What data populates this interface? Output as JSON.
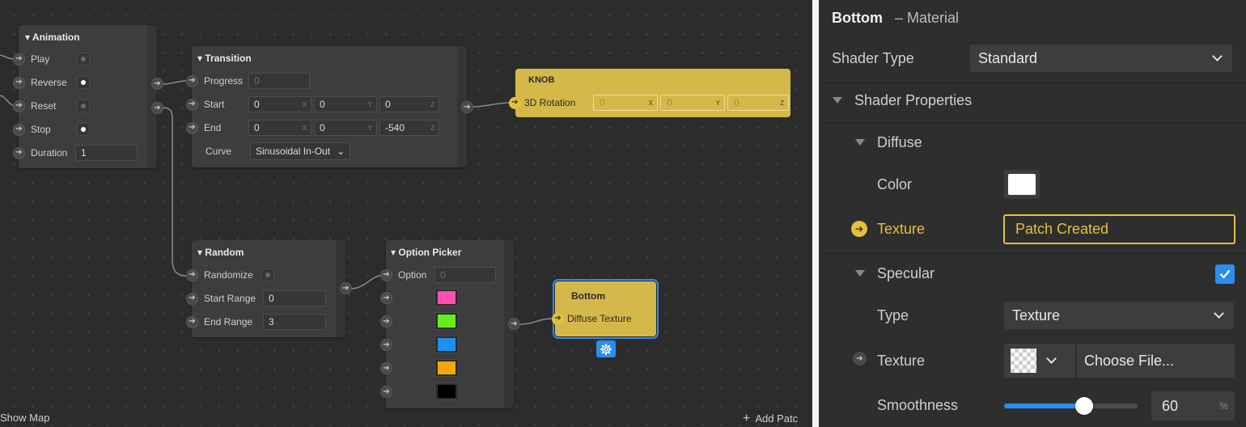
{
  "editor": {
    "show_map": "Show Map",
    "add_patch": "Add Patc",
    "animation": {
      "title": "Animation",
      "rows": [
        {
          "label": "Play",
          "checked": false
        },
        {
          "label": "Reverse",
          "checked": true
        },
        {
          "label": "Reset",
          "checked": false
        },
        {
          "label": "Stop",
          "checked": true
        }
      ],
      "duration_label": "Duration",
      "duration_value": "1"
    },
    "transition": {
      "title": "Transition",
      "progress_label": "Progress",
      "progress_value": "0",
      "start_label": "Start",
      "start_values": [
        "0",
        "0",
        "0"
      ],
      "end_label": "End",
      "end_values": [
        "0",
        "0",
        "-540"
      ],
      "axes": [
        "X",
        "Y",
        "Z"
      ],
      "curve_label": "Curve",
      "curve_value": "Sinusoidal In-Out"
    },
    "knob": {
      "title": "KNOB",
      "input_label": "3D Rotation",
      "values": [
        "0",
        "0",
        "0"
      ],
      "axes": [
        "X",
        "Y",
        "Z"
      ]
    },
    "random": {
      "title": "Random",
      "randomize_label": "Randomize",
      "start_range_label": "Start Range",
      "start_range_value": "0",
      "end_range_label": "End Range",
      "end_range_value": "3"
    },
    "option_picker": {
      "title": "Option Picker",
      "option_label": "Option",
      "option_value": "0",
      "swatches": [
        "#ff4fb0",
        "#66ee1a",
        "#1e8ff0",
        "#f5a60a",
        "#000000"
      ]
    },
    "bottom": {
      "title": "Bottom",
      "input_label": "Diffuse Texture",
      "selection_color": "#2d8cf0"
    }
  },
  "inspector": {
    "title": "Bottom",
    "subtitle": "– Material",
    "shader_type_label": "Shader Type",
    "shader_type_value": "Standard",
    "shader_properties_label": "Shader Properties",
    "diffuse_label": "Diffuse",
    "color_label": "Color",
    "color_value": "#ffffff",
    "texture_label": "Texture",
    "texture_value": "Patch Created",
    "specular_label": "Specular",
    "specular_checked": true,
    "type_label": "Type",
    "type_value": "Texture",
    "specular_texture_label": "Texture",
    "choose_file_label": "Choose File...",
    "smoothness_label": "Smoothness",
    "smoothness_value": "60",
    "smoothness_unit": "%",
    "smoothness_fraction": 0.6,
    "accent_color": "#e3c13a",
    "checkbox_color": "#2d8cf0"
  }
}
